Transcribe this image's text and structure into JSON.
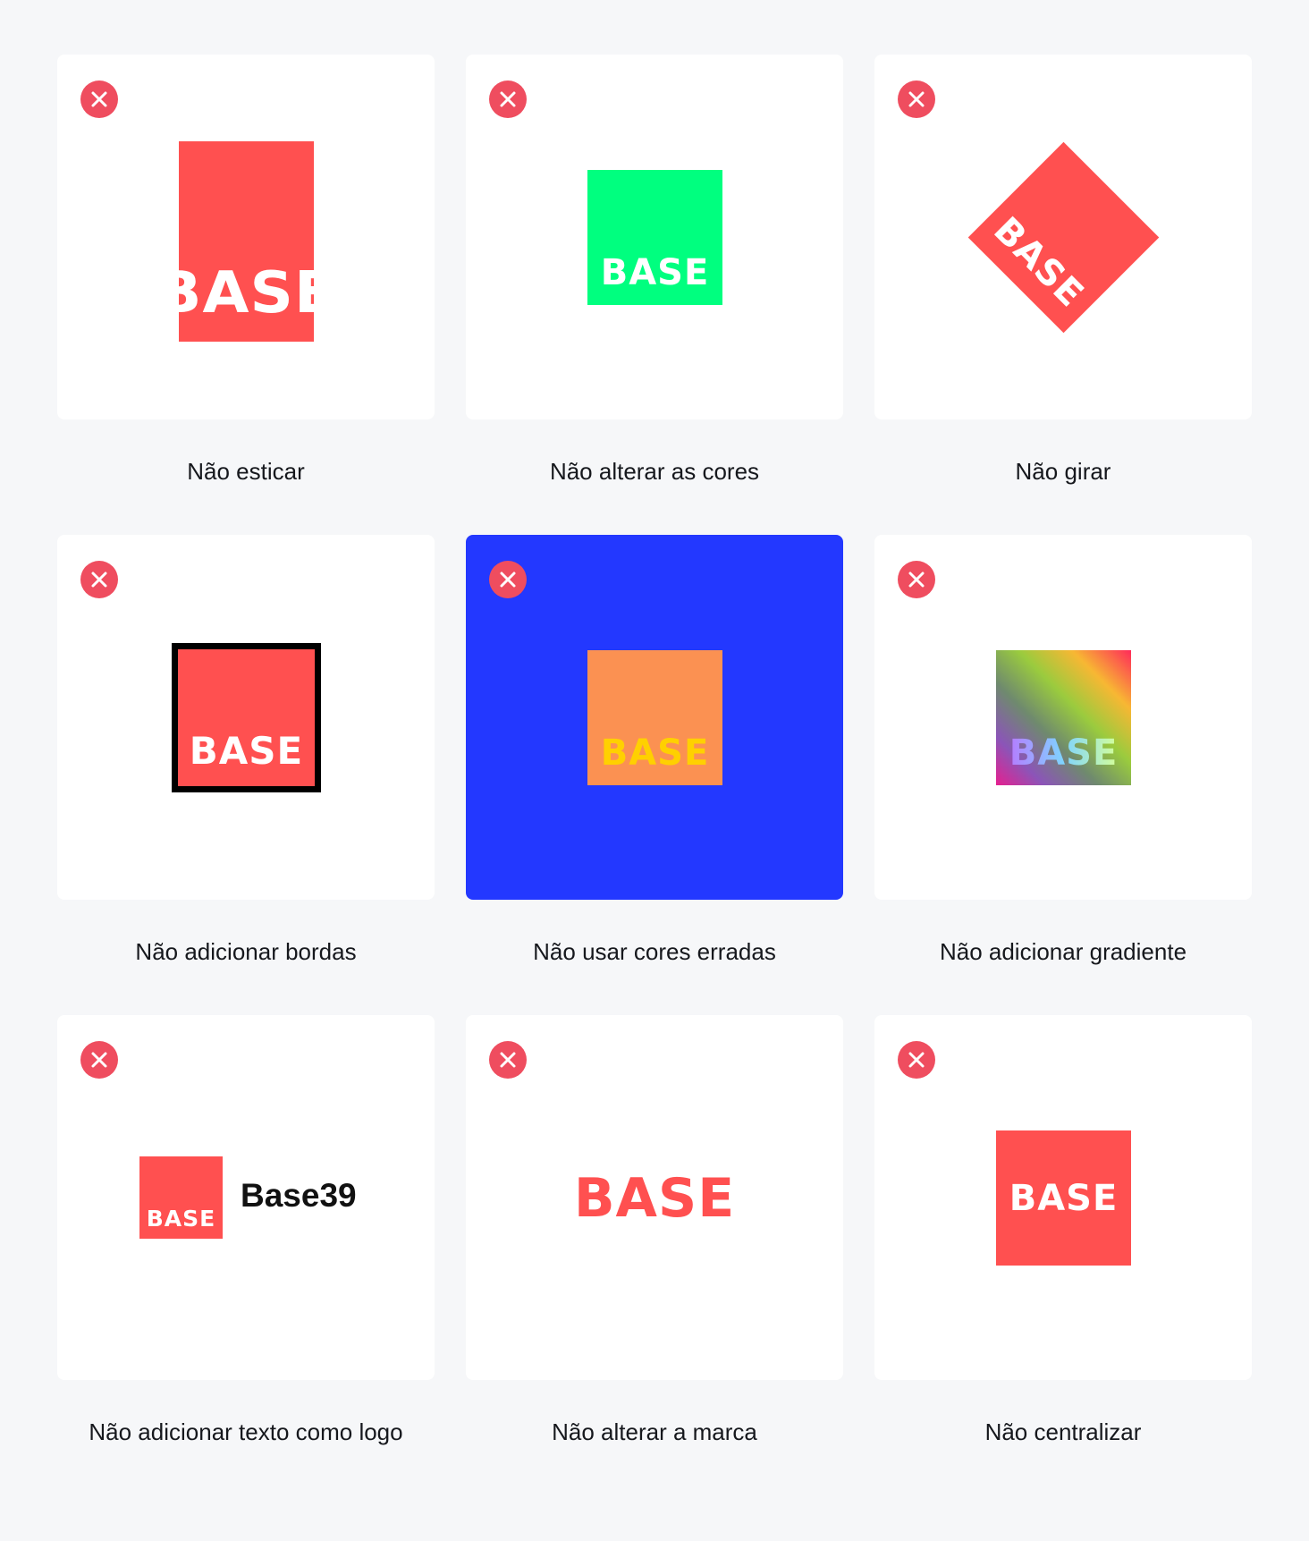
{
  "brand": {
    "wordmark": "BASE",
    "brand_color": "#ff5050",
    "error_color": "#ef4d5f"
  },
  "examples": [
    {
      "caption": "Não esticar",
      "error_icon": "close-icon"
    },
    {
      "caption": "Não alterar as cores",
      "error_icon": "close-icon",
      "logo_color": "#00ff7f"
    },
    {
      "caption": "Não girar",
      "error_icon": "close-icon"
    },
    {
      "caption": "Não adicionar bordas",
      "error_icon": "close-icon"
    },
    {
      "caption": "Não usar cores erradas",
      "error_icon": "close-icon",
      "card_color": "#2338ff",
      "logo_color": "#fb9152",
      "wordmark_color": "#ffd000"
    },
    {
      "caption": "Não adicionar gradiente",
      "error_icon": "close-icon"
    },
    {
      "caption": "Não adicionar texto como logo",
      "error_icon": "close-icon",
      "logo_text": "Base39"
    },
    {
      "caption": "Não alterar a marca",
      "error_icon": "close-icon"
    },
    {
      "caption": "Não centralizar",
      "error_icon": "close-icon"
    }
  ]
}
